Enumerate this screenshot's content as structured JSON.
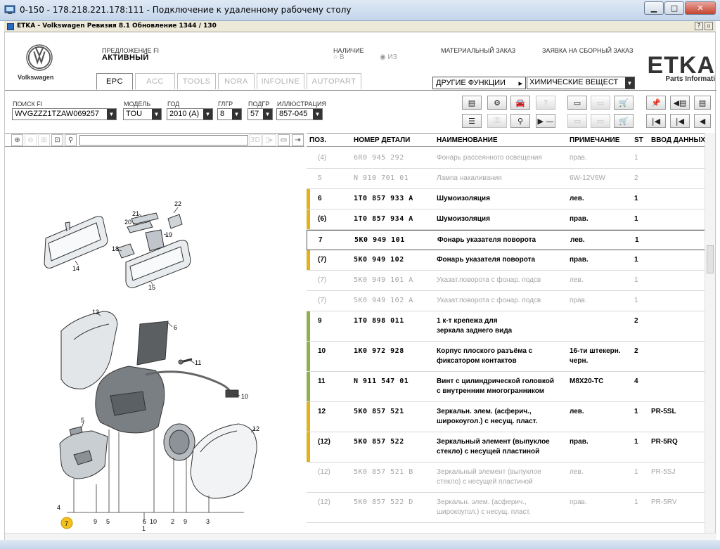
{
  "rdp": {
    "title": "0-150 - 178.218.221.178:111 - Подключение к удаленному рабочему столу"
  },
  "etka": {
    "title": "ETKA - Volkswagen Ревизия 8.1 Обновление 1344 / 130"
  },
  "header": {
    "brand": "Volkswagen",
    "offer_label": "ПРЕДЛОЖЕНИЕ FI",
    "offer_value": "АКТИВНЫЙ",
    "availability_label": "НАЛИЧИЕ",
    "radio_in": "В",
    "radio_from": "ИЗ",
    "material_order": "МАТЕРИАЛЬНЫЙ ЗАКАЗ",
    "assembly_order": "ЗАЯВКА НА СБОРНЫЙ ЗАКАЗ",
    "etka_logo": "ETKA",
    "etka_sub": "Parts Informati",
    "other_functions": "ДРУГИЕ ФУНКЦИИ",
    "chem_select": "ХИМИЧЕСКИЕ ВЕЩЕСТ"
  },
  "tabs": [
    "EPC",
    "ACC",
    "TOOLS",
    "NORA",
    "INFOLINE",
    "AUTOPART"
  ],
  "selectors": {
    "search_label": "ПОИСК FI",
    "search_value": "WVGZZZ1TZAW069257",
    "model_label": "МОДЕЛЬ",
    "model_value": "TOU",
    "year_label": "ГОД",
    "year_value": "2010 (A)",
    "mg_label": "ГЛГР",
    "mg_value": "8",
    "sg_label": "ПОДГР",
    "sg_value": "57",
    "illus_label": "ИЛЛЮСТРАЦИЯ",
    "illus_value": "857-045"
  },
  "illustration": {
    "callouts": [
      "22",
      "21",
      "20",
      "19",
      "18",
      "14",
      "15",
      "13",
      "6",
      "11",
      "10",
      "5",
      "12",
      "4",
      "7",
      "9",
      "5",
      "6",
      "10",
      "2",
      "9",
      "3",
      "1"
    ]
  },
  "grid": {
    "headers": {
      "pos": "ПОЗ.",
      "part": "НОМЕР ДЕТАЛИ",
      "name": "НАИМЕНОВАНИЕ",
      "note": "ПРИМЕЧАНИЕ",
      "st": "ST",
      "input": "ВВОД ДАННЫХ"
    },
    "rows": [
      {
        "pos": "(4)",
        "part": "6R0  945  292",
        "name": "Фонарь рассеянного освещения",
        "name2": "",
        "note": "прав.",
        "note2": "",
        "st": "1",
        "data": "",
        "style": "dim"
      },
      {
        "pos": "5",
        "part": "N      910  701  01",
        "name": "Лампа накаливания",
        "name2": "",
        "note": "6W-12V6W",
        "note2": "",
        "st": "2",
        "data": "",
        "style": "dim"
      },
      {
        "pos": "6",
        "part": "1T0  857  933  A",
        "name": "Шумоизоляция",
        "name2": "",
        "note": "лев.",
        "note2": "",
        "st": "1",
        "data": "",
        "style": "bold"
      },
      {
        "pos": "(6)",
        "part": "1T0  857  934  A",
        "name": "Шумоизоляция",
        "name2": "",
        "note": "прав.",
        "note2": "",
        "st": "1",
        "data": "",
        "style": "bold"
      },
      {
        "pos": "7",
        "part": "5K0  949  101",
        "name": "Фонарь указателя поворота",
        "name2": "",
        "note": "лев.",
        "note2": "",
        "st": "1",
        "data": "",
        "style": "bold"
      },
      {
        "pos": "(7)",
        "part": "5K0  949  102",
        "name": "Фонарь указателя поворота",
        "name2": "",
        "note": "прав.",
        "note2": "",
        "st": "1",
        "data": "",
        "style": "bold"
      },
      {
        "pos": "(7)",
        "part": "5K0  949  101  A",
        "name": "Указат.поворота с фонар. подсв",
        "name2": "",
        "note": "лев.",
        "note2": "",
        "st": "1",
        "data": "",
        "style": "dim"
      },
      {
        "pos": "(7)",
        "part": "5K0  949  102  A",
        "name": "Указат.поворота с фонар. подсв",
        "name2": "",
        "note": "прав.",
        "note2": "",
        "st": "1",
        "data": "",
        "style": "dim"
      },
      {
        "pos": "9",
        "part": "1T0  898  011",
        "name": "1 к-т крепежа для",
        "name2": "зеркала заднего вида",
        "note": "",
        "note2": "",
        "st": "2",
        "data": "",
        "style": "bold"
      },
      {
        "pos": "10",
        "part": "1K0  972  928",
        "name": "Корпус плоского разъёма с",
        "name2": "фиксатором контактов",
        "note": "16-ти штекерн.",
        "note2": "черн.",
        "st": "2",
        "data": "",
        "style": "bold"
      },
      {
        "pos": "11",
        "part": "N      911  547  01",
        "name": "Винт с цилиндрической головкой",
        "name2": "с внутренним многогранником",
        "note": "M8X20-TC",
        "note2": "",
        "st": "4",
        "data": "",
        "style": "bold"
      },
      {
        "pos": "12",
        "part": "5K0  857  521",
        "name": "Зеркальн. элем. (асферич.,",
        "name2": "широкоугол.) с несущ. пласт.",
        "note": "лев.",
        "note2": "",
        "st": "1",
        "data": "PR-5SL",
        "style": "bold"
      },
      {
        "pos": "(12)",
        "part": "5K0  857  522",
        "name": "Зеркальный элемент (выпуклое",
        "name2": "стекло) с несущей пластиной",
        "note": "прав.",
        "note2": "",
        "st": "1",
        "data": "PR-5RQ",
        "style": "bold"
      },
      {
        "pos": "(12)",
        "part": "5K0  857  521  B",
        "name": "Зеркальный элемент (выпуклое",
        "name2": "стекло) с несущей пластиной",
        "note": "лев.",
        "note2": "",
        "st": "1",
        "data": "PR-5SJ",
        "style": "dim"
      },
      {
        "pos": "(12)",
        "part": "5K0  857  522  D",
        "name": "Зеркальн. элем. (асферич.,",
        "name2": "широкоугол.) с несущ. пласт.",
        "note": "прав.",
        "note2": "",
        "st": "1",
        "data": "PR-5RV",
        "style": "dim"
      }
    ]
  },
  "colors": {
    "bar_yellow": "#e0b21e",
    "bar_green": "#8fb04a",
    "highlight_callout": "#f2c11b"
  }
}
